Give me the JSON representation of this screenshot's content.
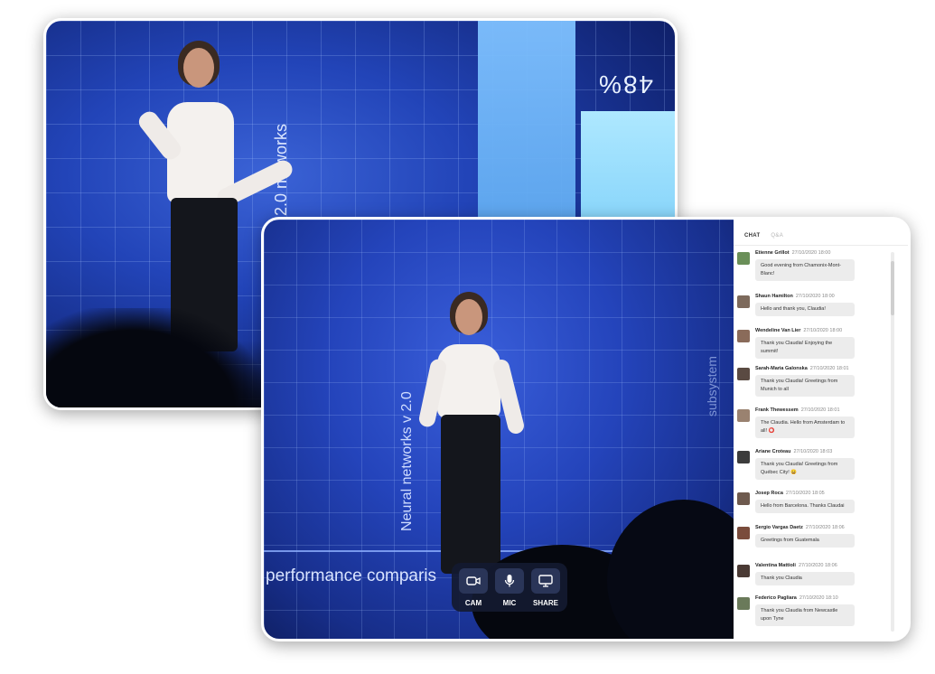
{
  "back_scene": {
    "percent_text": "48%",
    "vertical_text": "v 2.0 networks"
  },
  "video": {
    "vertical_text": "Neural networks v 2.0",
    "side_text": "subsystem",
    "bottom_text": "performance comparis"
  },
  "controls": [
    {
      "label": "CAM",
      "icon": "camera-icon"
    },
    {
      "label": "MIC",
      "icon": "microphone-icon"
    },
    {
      "label": "SHARE",
      "icon": "screen-share-icon"
    }
  ],
  "chat": {
    "tabs": [
      "CHAT",
      "Q&A"
    ],
    "active_tab": "CHAT",
    "messages": [
      {
        "name": "Etienne Grillot",
        "time": "27/10/2020 18:00",
        "text": "Good evening from Chamonix-Mont-Blanc!"
      },
      {
        "name": "Shaun Hamilton",
        "time": "27/10/2020 18:00",
        "text": "Hello and thank you, Claudia!"
      },
      {
        "name": "Wendeline Van Lier",
        "time": "27/10/2020 18:00",
        "text": "Thank you Claudia! Enjoying the summit!"
      },
      {
        "name": "Sarah-Maria Galonska",
        "time": "27/10/2020 18:01",
        "text": "Thank you Claudia! Greetings from Munich to all"
      },
      {
        "name": "Frank Thewessem",
        "time": "27/10/2020 18:01",
        "text": "The Claudia. Hello from Amsterdam to all! ⭕"
      },
      {
        "name": "Ariane Croteau",
        "time": "27/10/2020 18:03",
        "text": "Thank you Claudia! Greetings from Québec City! 😄"
      },
      {
        "name": "Josep Roca",
        "time": "27/10/2020 18:05",
        "text": "Hello from Barcelona. Thanks Claudai"
      },
      {
        "name": "Sergio Vargas Daetz",
        "time": "27/10/2020 18:06",
        "text": "Greetings from Guatemala"
      },
      {
        "name": "Valentina Mattioli",
        "time": "27/10/2020 18:06",
        "text": "Thank you Claudia"
      },
      {
        "name": "Federico Pagliara",
        "time": "27/10/2020 18:10",
        "text": "Thank you Claudia from Newcastle upon Tyne"
      }
    ]
  },
  "colors": {
    "stage_blue": "#2444bb",
    "bubble_gray": "#ececec",
    "control_bg": "#141a30"
  }
}
